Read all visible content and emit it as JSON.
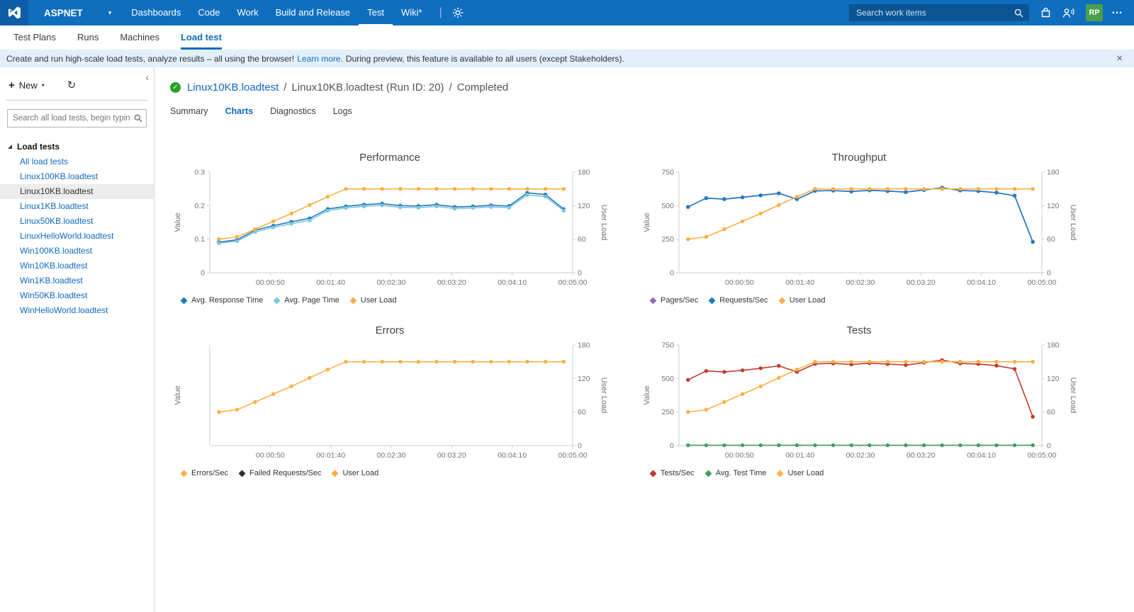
{
  "topbar": {
    "project": "ASPNET",
    "nav_items": [
      {
        "label": "Dashboards",
        "active": false
      },
      {
        "label": "Code",
        "active": false
      },
      {
        "label": "Work",
        "active": false
      },
      {
        "label": "Build and Release",
        "active": false
      },
      {
        "label": "Test",
        "active": true
      },
      {
        "label": "Wiki*",
        "active": false
      }
    ],
    "search_placeholder": "Search work items",
    "avatar_initials": "RP"
  },
  "icons": {
    "chevron_down": "▾",
    "refresh": "↻",
    "collapse": "‹",
    "close": "×",
    "ellipsis": "…",
    "plus": "+",
    "check": "✓",
    "divider": "|"
  },
  "hub_tabs": [
    {
      "label": "Test Plans",
      "active": false
    },
    {
      "label": "Runs",
      "active": false
    },
    {
      "label": "Machines",
      "active": false
    },
    {
      "label": "Load test",
      "active": true
    }
  ],
  "banner": {
    "text_before_link": "Create and run high-scale load tests, analyze results – all using the browser!",
    "link": "Learn more.",
    "text_after_link": "During preview, this feature is available to all users (except Stakeholders)."
  },
  "sidebar": {
    "new_button": "New",
    "search_placeholder": "Search all load tests, begin typing to...",
    "tree_root": "Load tests",
    "items": [
      {
        "label": "All load tests",
        "selected": false
      },
      {
        "label": "Linux100KB.loadtest",
        "selected": false
      },
      {
        "label": "Linux10KB.loadtest",
        "selected": true
      },
      {
        "label": "Linux1KB.loadtest",
        "selected": false
      },
      {
        "label": "Linux50KB.loadtest",
        "selected": false
      },
      {
        "label": "LinuxHelloWorld.loadtest",
        "selected": false
      },
      {
        "label": "Win100KB.loadtest",
        "selected": false
      },
      {
        "label": "Win10KB.loadtest",
        "selected": false
      },
      {
        "label": "Win1KB.loadtest",
        "selected": false
      },
      {
        "label": "Win50KB.loadtest",
        "selected": false
      },
      {
        "label": "WinHelloWorld.loadtest",
        "selected": false
      }
    ]
  },
  "run_header": {
    "test_link": "Linux10KB.loadtest",
    "separator": "/",
    "run_label": "Linux10KB.loadtest (Run ID: 20)",
    "status": "Completed"
  },
  "main_tabs": [
    {
      "label": "Summary",
      "active": false
    },
    {
      "label": "Charts",
      "active": true
    },
    {
      "label": "Diagnostics",
      "active": false
    },
    {
      "label": "Logs",
      "active": false
    }
  ],
  "chart_data": [
    {
      "type": "line",
      "title": "Performance",
      "duration_seconds": 300,
      "sample_interval_seconds": 15,
      "x_ticks": [
        {
          "t": 50,
          "label": "00:00:50"
        },
        {
          "t": 100,
          "label": "00:01:40"
        },
        {
          "t": 150,
          "label": "00:02:30"
        },
        {
          "t": 200,
          "label": "00:03:20"
        },
        {
          "t": 250,
          "label": "00:04:10"
        },
        {
          "t": 300,
          "label": "00:05:00"
        }
      ],
      "left_axis": {
        "label": "Value",
        "max": 0.3,
        "ticks": [
          0,
          0.1,
          0.2,
          0.3
        ]
      },
      "right_axis": {
        "label": "User Load",
        "max": 180,
        "ticks": [
          0,
          60,
          120,
          180
        ]
      },
      "series": [
        {
          "name": "Avg. Response Time",
          "color": "#1E79C2",
          "axis": "left",
          "values": [
            0.091,
            0.098,
            0.127,
            0.14,
            0.152,
            0.162,
            0.19,
            0.198,
            0.203,
            0.206,
            0.2,
            0.199,
            0.203,
            0.196,
            0.198,
            0.201,
            0.199,
            0.238,
            0.233,
            0.19
          ]
        },
        {
          "name": "Avg. Page Time",
          "color": "#7FC6DC",
          "axis": "left",
          "values": [
            0.088,
            0.094,
            0.122,
            0.135,
            0.146,
            0.156,
            0.185,
            0.193,
            0.198,
            0.201,
            0.195,
            0.194,
            0.198,
            0.191,
            0.193,
            0.196,
            0.194,
            0.232,
            0.227,
            0.185
          ]
        },
        {
          "name": "User Load",
          "color": "#FBB045",
          "axis": "right",
          "values": [
            60,
            64,
            78,
            92,
            106,
            121,
            136,
            150,
            150,
            150,
            150,
            150,
            150,
            150,
            150,
            150,
            150,
            150,
            150,
            150
          ]
        }
      ]
    },
    {
      "type": "line",
      "title": "Throughput",
      "duration_seconds": 300,
      "sample_interval_seconds": 15,
      "x_ticks": [
        {
          "t": 50,
          "label": "00:00:50"
        },
        {
          "t": 100,
          "label": "00:01:40"
        },
        {
          "t": 150,
          "label": "00:02:30"
        },
        {
          "t": 200,
          "label": "00:03:20"
        },
        {
          "t": 250,
          "label": "00:04:10"
        },
        {
          "t": 300,
          "label": "00:05:00"
        }
      ],
      "left_axis": {
        "label": "Value",
        "max": 750,
        "ticks": [
          0,
          250,
          500,
          750
        ]
      },
      "right_axis": {
        "label": "User Load",
        "max": 180,
        "ticks": [
          0,
          60,
          120,
          180
        ]
      },
      "series": [
        {
          "name": "Pages/Sec",
          "color": "#9467BD",
          "axis": "left",
          "values": [
            490,
            556,
            549,
            562,
            577,
            592,
            549,
            610,
            612,
            606,
            614,
            609,
            601,
            617,
            634,
            613,
            609,
            597,
            574,
            230
          ]
        },
        {
          "name": "Requests/Sec",
          "color": "#1E79C2",
          "axis": "left",
          "values": [
            490,
            556,
            549,
            562,
            577,
            592,
            549,
            610,
            612,
            606,
            614,
            609,
            601,
            617,
            634,
            613,
            609,
            597,
            574,
            230
          ]
        },
        {
          "name": "User Load",
          "color": "#FBB045",
          "axis": "right",
          "values": [
            60,
            64,
            78,
            92,
            106,
            121,
            136,
            150,
            150,
            150,
            150,
            150,
            150,
            150,
            150,
            150,
            150,
            150,
            150,
            150
          ]
        }
      ]
    },
    {
      "type": "line",
      "title": "Errors",
      "duration_seconds": 300,
      "sample_interval_seconds": 15,
      "x_ticks": [
        {
          "t": 50,
          "label": "00:00:50"
        },
        {
          "t": 100,
          "label": "00:01:40"
        },
        {
          "t": 150,
          "label": "00:02:30"
        },
        {
          "t": 200,
          "label": "00:03:20"
        },
        {
          "t": 250,
          "label": "00:04:10"
        },
        {
          "t": 300,
          "label": "00:05:00"
        }
      ],
      "left_axis": {
        "label": "Value",
        "max": 1,
        "ticks": []
      },
      "right_axis": {
        "label": "User Load",
        "max": 180,
        "ticks": [
          0,
          60,
          120,
          180
        ]
      },
      "series": [
        {
          "name": "Errors/Sec",
          "color": "#FBB045",
          "axis": "left",
          "values": []
        },
        {
          "name": "Failed Requests/Sec",
          "color": "#2D2D2D",
          "axis": "left",
          "values": []
        },
        {
          "name": "User Load",
          "color": "#FBB045",
          "axis": "right",
          "values": [
            60,
            64,
            78,
            92,
            106,
            121,
            136,
            150,
            150,
            150,
            150,
            150,
            150,
            150,
            150,
            150,
            150,
            150,
            150,
            150
          ]
        }
      ]
    },
    {
      "type": "line",
      "title": "Tests",
      "duration_seconds": 300,
      "sample_interval_seconds": 15,
      "x_ticks": [
        {
          "t": 50,
          "label": "00:00:50"
        },
        {
          "t": 100,
          "label": "00:01:40"
        },
        {
          "t": 150,
          "label": "00:02:30"
        },
        {
          "t": 200,
          "label": "00:03:20"
        },
        {
          "t": 250,
          "label": "00:04:10"
        },
        {
          "t": 300,
          "label": "00:05:00"
        }
      ],
      "left_axis": {
        "label": "Value",
        "max": 750,
        "ticks": [
          0,
          250,
          500,
          750
        ]
      },
      "right_axis": {
        "label": "User Load",
        "max": 180,
        "ticks": [
          0,
          60,
          120,
          180
        ]
      },
      "series": [
        {
          "name": "Tests/Sec",
          "color": "#C0392B",
          "axis": "left",
          "values": [
            490,
            556,
            549,
            561,
            576,
            594,
            549,
            609,
            612,
            605,
            614,
            608,
            600,
            618,
            637,
            612,
            608,
            596,
            571,
            215
          ]
        },
        {
          "name": "Avg. Test Time",
          "color": "#3F9E5F",
          "axis": "left",
          "values": [
            2,
            2,
            2,
            2,
            2,
            2,
            2,
            2,
            2,
            2,
            2,
            2,
            2,
            2,
            2,
            2,
            2,
            2,
            2,
            2
          ]
        },
        {
          "name": "User Load",
          "color": "#FBB045",
          "axis": "right",
          "values": [
            60,
            64,
            78,
            92,
            106,
            121,
            136,
            150,
            150,
            150,
            150,
            150,
            150,
            150,
            150,
            150,
            150,
            150,
            150,
            150
          ]
        }
      ]
    }
  ]
}
